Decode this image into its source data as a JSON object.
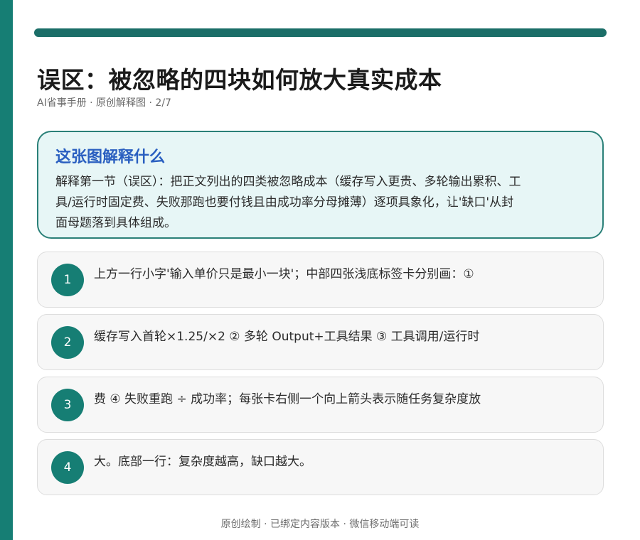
{
  "header": {
    "title": "误区：被忽略的四块如何放大真实成本",
    "subtitle": "AI省事手册 · 原创解释图 · 2/7"
  },
  "explain": {
    "heading": "这张图解释什么",
    "body": "解释第一节（误区）：把正文列出的四类被忽略成本（缓存写入更贵、多轮输出累积、工具/运行时固定费、失败那跑也要付钱且由成功率分母摊薄）逐项具象化，让'缺口'从封面母题落到具体组成。"
  },
  "steps": [
    {
      "num": "1",
      "text": "上方一行小字'输入单价只是最小一块'；中部四张浅底标签卡分别画：①"
    },
    {
      "num": "2",
      "text": "缓存写入首轮×1.25/×2 ② 多轮 Output+工具结果 ③ 工具调用/运行时"
    },
    {
      "num": "3",
      "text": "费 ④ 失败重跑 ÷ 成功率；每张卡右侧一个向上箭头表示随任务复杂度放"
    },
    {
      "num": "4",
      "text": "大。底部一行：复杂度越高，缺口越大。"
    }
  ],
  "footer": {
    "text": "原创绘制 · 已绑定内容版本 · 微信移动端可读"
  },
  "colors": {
    "accent_teal": "#167e74",
    "top_rule": "#1b6e68",
    "heading_blue": "#2a5fc0",
    "explain_bg": "#e7f6f6"
  }
}
